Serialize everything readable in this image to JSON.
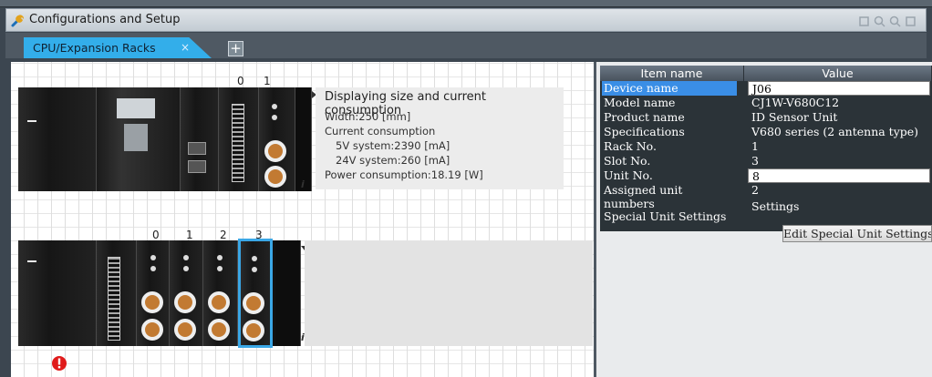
{
  "window": {
    "title": "Configurations and Setup"
  },
  "tabs": [
    {
      "label": "CPU/Expansion Racks",
      "close": "×"
    }
  ],
  "add_tab_symbol": "+",
  "racks": {
    "rack0_slots": [
      "0",
      "1"
    ],
    "rack1_slots": [
      "0",
      "1",
      "2",
      "3"
    ],
    "info_mark": "i",
    "selected_slot": "3",
    "error_present": true
  },
  "info": {
    "heading": "Displaying size and current consumption",
    "width": "Width:250 [mm]",
    "current": "Current consumption",
    "v5": "5V system:2390 [mA]",
    "v24": "24V system:260 [mA]",
    "power": "Power consumption:18.19 [W]"
  },
  "properties": {
    "col_item": "Item name",
    "col_value": "Value",
    "rows": [
      {
        "key": "Device name",
        "value": "J06"
      },
      {
        "key": "Model name",
        "value": "CJ1W-V680C12"
      },
      {
        "key": "Product name",
        "value": "ID Sensor Unit"
      },
      {
        "key": "Specifications",
        "value": "V680 series (2 antenna type)"
      },
      {
        "key": "Rack No.",
        "value": "1"
      },
      {
        "key": "Slot No.",
        "value": "3"
      },
      {
        "key": "Unit No.",
        "value": "8"
      },
      {
        "key": "Assigned unit numbers",
        "value": "2"
      }
    ],
    "special_key": "Special Unit Settings",
    "special_value": "Settings",
    "edit_button": "Edit Special Unit Settings"
  },
  "colors": {
    "accent": "#33aeea",
    "selected_row": "#3a8ee6",
    "error": "#e01b1b"
  }
}
